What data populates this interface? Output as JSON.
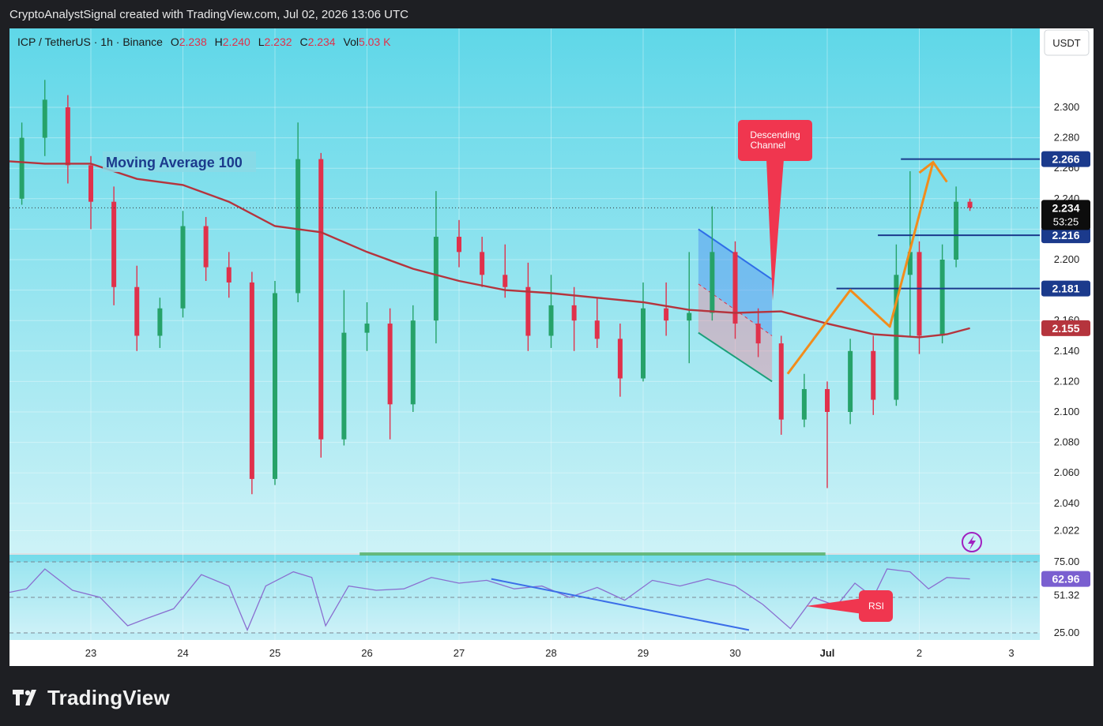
{
  "header": {
    "attribution": "CryptoAnalystSignal created with TradingView.com, Jul 02, 2026 13:06 UTC"
  },
  "legend": {
    "symbol": "ICP / TetherUS · 1h · Binance",
    "o_label": "O",
    "o": "2.238",
    "h_label": "H",
    "h": "2.240",
    "l_label": "L",
    "l": "2.232",
    "c_label": "C",
    "c": "2.234",
    "vol_label": "Vol",
    "vol": "5.03 K"
  },
  "currency_button": "USDT",
  "ma_label": "Moving Average 100",
  "callouts": {
    "channel_line1": "Descending",
    "channel_line2": "Channel",
    "rsi": "RSI"
  },
  "footer": {
    "brand": "TradingView"
  },
  "colors": {
    "bg_top": "#5fd7e8",
    "bg_bottom": "#c9f1f7",
    "up": "#26a269",
    "down": "#e0314b",
    "ma": "#b5343d",
    "level": "#1b3a8c",
    "orange": "#f28c1b",
    "trend": "#3b6ee8",
    "rsi": "#8a6fd0"
  },
  "chart_data": {
    "type": "candlestick",
    "pair": "ICP / TetherUS",
    "interval": "1h",
    "exchange": "Binance",
    "price_axis": {
      "ticks": [
        "2.300",
        "2.280",
        "2.260",
        "2.240",
        "2.220",
        "2.200",
        "2.180",
        "2.160",
        "2.140",
        "2.120",
        "2.100",
        "2.080",
        "2.060",
        "2.040",
        "2.022"
      ],
      "ylim": [
        2.022,
        2.33
      ]
    },
    "time_axis": {
      "ticks": [
        "23",
        "24",
        "25",
        "26",
        "27",
        "28",
        "29",
        "30",
        "Jul",
        "2",
        "3"
      ]
    },
    "last_price": {
      "value": "2.234",
      "countdown": "53:25"
    },
    "levels": [
      {
        "value": "2.266",
        "role": "resistance"
      },
      {
        "value": "2.216",
        "role": "support"
      },
      {
        "value": "2.181",
        "role": "support"
      }
    ],
    "moving_average": {
      "name": "Moving Average 100",
      "current": "2.155"
    },
    "ma100": [
      {
        "x": 22.0,
        "y": 2.265
      },
      {
        "x": 22.5,
        "y": 2.263
      },
      {
        "x": 23.0,
        "y": 2.263
      },
      {
        "x": 23.5,
        "y": 2.253
      },
      {
        "x": 24.0,
        "y": 2.249
      },
      {
        "x": 24.5,
        "y": 2.238
      },
      {
        "x": 25.0,
        "y": 2.222
      },
      {
        "x": 25.5,
        "y": 2.218
      },
      {
        "x": 26.0,
        "y": 2.205
      },
      {
        "x": 26.5,
        "y": 2.194
      },
      {
        "x": 27.0,
        "y": 2.186
      },
      {
        "x": 27.5,
        "y": 2.18
      },
      {
        "x": 28.0,
        "y": 2.178
      },
      {
        "x": 28.5,
        "y": 2.175
      },
      {
        "x": 29.0,
        "y": 2.172
      },
      {
        "x": 29.5,
        "y": 2.167
      },
      {
        "x": 30.0,
        "y": 2.165
      },
      {
        "x": 30.5,
        "y": 2.166
      },
      {
        "x": 31.0,
        "y": 2.158
      },
      {
        "x": 31.5,
        "y": 2.151
      },
      {
        "x": 32.0,
        "y": 2.149
      },
      {
        "x": 32.3,
        "y": 2.151
      },
      {
        "x": 32.55,
        "y": 2.155
      }
    ],
    "candles": [
      {
        "x": 22.0,
        "o": 2.23,
        "h": 2.245,
        "l": 2.222,
        "c": 2.24
      },
      {
        "x": 22.25,
        "o": 2.24,
        "h": 2.29,
        "l": 2.236,
        "c": 2.28
      },
      {
        "x": 22.5,
        "o": 2.28,
        "h": 2.318,
        "l": 2.268,
        "c": 2.305
      },
      {
        "x": 22.75,
        "o": 2.3,
        "h": 2.308,
        "l": 2.25,
        "c": 2.262
      },
      {
        "x": 23.0,
        "o": 2.262,
        "h": 2.268,
        "l": 2.22,
        "c": 2.238
      },
      {
        "x": 23.25,
        "o": 2.238,
        "h": 2.248,
        "l": 2.17,
        "c": 2.182
      },
      {
        "x": 23.5,
        "o": 2.182,
        "h": 2.196,
        "l": 2.14,
        "c": 2.15
      },
      {
        "x": 23.75,
        "o": 2.15,
        "h": 2.175,
        "l": 2.142,
        "c": 2.168
      },
      {
        "x": 24.0,
        "o": 2.168,
        "h": 2.232,
        "l": 2.162,
        "c": 2.222
      },
      {
        "x": 24.25,
        "o": 2.222,
        "h": 2.228,
        "l": 2.186,
        "c": 2.195
      },
      {
        "x": 24.5,
        "o": 2.195,
        "h": 2.205,
        "l": 2.175,
        "c": 2.185
      },
      {
        "x": 24.75,
        "o": 2.185,
        "h": 2.192,
        "l": 2.046,
        "c": 2.056
      },
      {
        "x": 25.0,
        "o": 2.056,
        "h": 2.186,
        "l": 2.052,
        "c": 2.178
      },
      {
        "x": 25.25,
        "o": 2.178,
        "h": 2.29,
        "l": 2.172,
        "c": 2.266
      },
      {
        "x": 25.5,
        "o": 2.266,
        "h": 2.27,
        "l": 2.07,
        "c": 2.082
      },
      {
        "x": 25.75,
        "o": 2.082,
        "h": 2.18,
        "l": 2.078,
        "c": 2.152
      },
      {
        "x": 26.0,
        "o": 2.152,
        "h": 2.172,
        "l": 2.14,
        "c": 2.158
      },
      {
        "x": 26.25,
        "o": 2.158,
        "h": 2.168,
        "l": 2.082,
        "c": 2.105
      },
      {
        "x": 26.5,
        "o": 2.105,
        "h": 2.17,
        "l": 2.1,
        "c": 2.16
      },
      {
        "x": 26.75,
        "o": 2.16,
        "h": 2.245,
        "l": 2.145,
        "c": 2.215
      },
      {
        "x": 27.0,
        "o": 2.215,
        "h": 2.226,
        "l": 2.195,
        "c": 2.205
      },
      {
        "x": 27.25,
        "o": 2.205,
        "h": 2.215,
        "l": 2.182,
        "c": 2.19
      },
      {
        "x": 27.5,
        "o": 2.19,
        "h": 2.21,
        "l": 2.175,
        "c": 2.182
      },
      {
        "x": 27.75,
        "o": 2.182,
        "h": 2.198,
        "l": 2.14,
        "c": 2.15
      },
      {
        "x": 28.0,
        "o": 2.15,
        "h": 2.19,
        "l": 2.142,
        "c": 2.17
      },
      {
        "x": 28.25,
        "o": 2.17,
        "h": 2.182,
        "l": 2.14,
        "c": 2.16
      },
      {
        "x": 28.5,
        "o": 2.16,
        "h": 2.175,
        "l": 2.142,
        "c": 2.148
      },
      {
        "x": 28.75,
        "o": 2.148,
        "h": 2.158,
        "l": 2.11,
        "c": 2.122
      },
      {
        "x": 29.0,
        "o": 2.122,
        "h": 2.185,
        "l": 2.12,
        "c": 2.168
      },
      {
        "x": 29.25,
        "o": 2.168,
        "h": 2.185,
        "l": 2.15,
        "c": 2.16
      },
      {
        "x": 29.5,
        "o": 2.16,
        "h": 2.205,
        "l": 2.132,
        "c": 2.165
      },
      {
        "x": 29.75,
        "o": 2.165,
        "h": 2.235,
        "l": 2.16,
        "c": 2.205
      },
      {
        "x": 30.0,
        "o": 2.205,
        "h": 2.212,
        "l": 2.148,
        "c": 2.158
      },
      {
        "x": 30.25,
        "o": 2.158,
        "h": 2.168,
        "l": 2.136,
        "c": 2.145
      },
      {
        "x": 30.5,
        "o": 2.145,
        "h": 2.15,
        "l": 2.085,
        "c": 2.095
      },
      {
        "x": 30.75,
        "o": 2.095,
        "h": 2.125,
        "l": 2.09,
        "c": 2.115
      },
      {
        "x": 31.0,
        "o": 2.115,
        "h": 2.12,
        "l": 2.05,
        "c": 2.1
      },
      {
        "x": 31.25,
        "o": 2.1,
        "h": 2.148,
        "l": 2.092,
        "c": 2.14
      },
      {
        "x": 31.5,
        "o": 2.14,
        "h": 2.15,
        "l": 2.098,
        "c": 2.108
      },
      {
        "x": 31.75,
        "o": 2.108,
        "h": 2.21,
        "l": 2.104,
        "c": 2.19
      },
      {
        "x": 31.9,
        "o": 2.19,
        "h": 2.258,
        "l": 2.15,
        "c": 2.205
      },
      {
        "x": 32.0,
        "o": 2.205,
        "h": 2.212,
        "l": 2.138,
        "c": 2.15
      },
      {
        "x": 32.25,
        "o": 2.15,
        "h": 2.21,
        "l": 2.145,
        "c": 2.2
      },
      {
        "x": 32.4,
        "o": 2.2,
        "h": 2.248,
        "l": 2.195,
        "c": 2.238
      },
      {
        "x": 32.55,
        "o": 2.238,
        "h": 2.24,
        "l": 2.232,
        "c": 2.234
      }
    ],
    "rsi": {
      "name": "RSI",
      "ticks": [
        "75.00",
        "60.67",
        "51.32",
        "25.00"
      ],
      "current": "62.96",
      "ylim": [
        20,
        80
      ],
      "points": [
        {
          "x": 22.0,
          "y": 52
        },
        {
          "x": 22.3,
          "y": 56
        },
        {
          "x": 22.5,
          "y": 70
        },
        {
          "x": 22.8,
          "y": 55
        },
        {
          "x": 23.1,
          "y": 50
        },
        {
          "x": 23.4,
          "y": 30
        },
        {
          "x": 23.6,
          "y": 35
        },
        {
          "x": 23.9,
          "y": 42
        },
        {
          "x": 24.2,
          "y": 66
        },
        {
          "x": 24.5,
          "y": 58
        },
        {
          "x": 24.7,
          "y": 27
        },
        {
          "x": 24.9,
          "y": 58
        },
        {
          "x": 25.2,
          "y": 68
        },
        {
          "x": 25.4,
          "y": 64
        },
        {
          "x": 25.55,
          "y": 30
        },
        {
          "x": 25.8,
          "y": 58
        },
        {
          "x": 26.1,
          "y": 55
        },
        {
          "x": 26.4,
          "y": 56
        },
        {
          "x": 26.7,
          "y": 64
        },
        {
          "x": 27.0,
          "y": 60
        },
        {
          "x": 27.3,
          "y": 62
        },
        {
          "x": 27.6,
          "y": 56
        },
        {
          "x": 27.9,
          "y": 58
        },
        {
          "x": 28.2,
          "y": 50
        },
        {
          "x": 28.5,
          "y": 57
        },
        {
          "x": 28.8,
          "y": 48
        },
        {
          "x": 29.1,
          "y": 62
        },
        {
          "x": 29.4,
          "y": 58
        },
        {
          "x": 29.7,
          "y": 63
        },
        {
          "x": 30.0,
          "y": 58
        },
        {
          "x": 30.3,
          "y": 45
        },
        {
          "x": 30.6,
          "y": 28
        },
        {
          "x": 30.85,
          "y": 50
        },
        {
          "x": 31.1,
          "y": 44
        },
        {
          "x": 31.3,
          "y": 60
        },
        {
          "x": 31.5,
          "y": 50
        },
        {
          "x": 31.65,
          "y": 70
        },
        {
          "x": 31.9,
          "y": 68
        },
        {
          "x": 32.1,
          "y": 56
        },
        {
          "x": 32.3,
          "y": 64
        },
        {
          "x": 32.55,
          "y": 63
        }
      ]
    }
  }
}
